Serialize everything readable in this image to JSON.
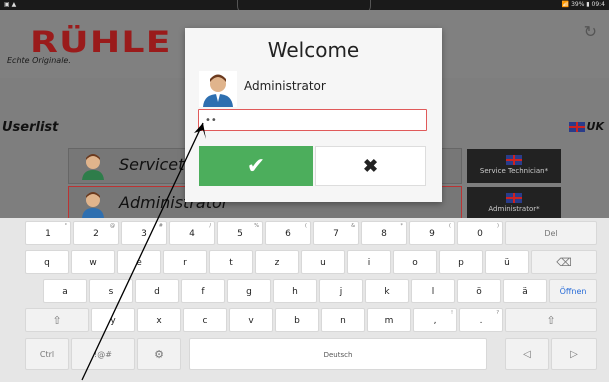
{
  "status": {
    "left": "▣ ▲",
    "right": "📶 39% ▮ 09:4"
  },
  "header": {
    "logo_text": "RÜHLE",
    "tagline": "Echte Originale."
  },
  "main": {
    "userlist_title": "Userlist",
    "language": "UK",
    "users": [
      {
        "name": "Servicete",
        "role": "Service Technician*"
      },
      {
        "name": "Administrator",
        "role": "Administrator*"
      }
    ]
  },
  "dialog": {
    "title": "Welcome",
    "user": "Administrator",
    "password_value": "..",
    "ok_icon": "✔",
    "cancel_icon": "✖"
  },
  "keyboard": {
    "row1": [
      [
        "1",
        "°"
      ],
      [
        "2",
        "@"
      ],
      [
        "3",
        "#"
      ],
      [
        "4",
        "/"
      ],
      [
        "5",
        "%"
      ],
      [
        "6",
        "("
      ],
      [
        "7",
        "&"
      ],
      [
        "8",
        "*"
      ],
      [
        "9",
        "("
      ],
      [
        "0",
        ")"
      ]
    ],
    "row1_end": "Del",
    "row2": [
      "q",
      "w",
      "e",
      "r",
      "t",
      "z",
      "u",
      "i",
      "o",
      "p",
      "ü"
    ],
    "row2_end": "⌫",
    "row3": [
      "a",
      "s",
      "d",
      "f",
      "g",
      "h",
      "j",
      "k",
      "l",
      "ö",
      "ä"
    ],
    "row3_end": "Öffnen",
    "row4_left": "⇧",
    "row4": [
      "y",
      "x",
      "c",
      "v",
      "b",
      "n",
      "m",
      ",",
      "."
    ],
    "row4_sup": [
      "",
      "",
      "",
      "",
      "",
      "",
      "",
      "!",
      "?"
    ],
    "row4_right": "⇧",
    "row5": {
      "ctrl": "Ctrl",
      "sym": "!@#",
      "settings": "⚙",
      "space": "Deutsch",
      "left": "◁",
      "right": "▷"
    }
  },
  "colors": {
    "ok": "#4cae5c",
    "logo": "#9a1b1b",
    "pwd_border": "#e05a5a"
  }
}
